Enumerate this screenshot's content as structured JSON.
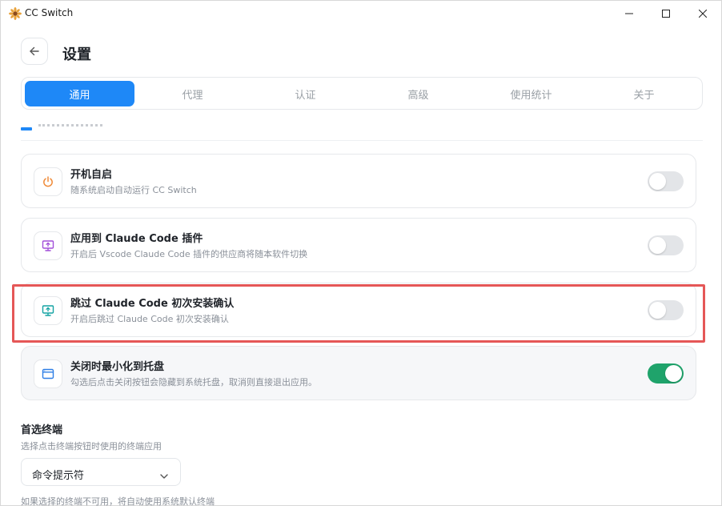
{
  "window": {
    "title": "CC Switch",
    "icon": "sunflower-app-icon"
  },
  "header": {
    "back_icon": "arrow-left-icon",
    "title": "设置"
  },
  "tabs": [
    {
      "label": "通用",
      "active": true
    },
    {
      "label": "代理",
      "active": false
    },
    {
      "label": "认证",
      "active": false
    },
    {
      "label": "高级",
      "active": false
    },
    {
      "label": "使用统计",
      "active": false
    },
    {
      "label": "关于",
      "active": false
    }
  ],
  "settings": [
    {
      "title": "开机自启",
      "desc": "随系统启动自动运行 CC Switch",
      "icon": "power-icon",
      "enabled": false
    },
    {
      "title": "应用到 Claude Code 插件",
      "desc": "开启后 Vscode Claude Code 插件的供应商将随本软件切换",
      "icon": "monitor-upload-icon",
      "enabled": false
    },
    {
      "title": "跳过 Claude Code 初次安装确认",
      "desc": "开启后跳过 Claude Code 初次安装确认",
      "icon": "monitor-upload-icon",
      "enabled": false
    },
    {
      "title": "关闭时最小化到托盘",
      "desc": "勾选后点击关闭按钮会隐藏到系统托盘，取消则直接退出应用。",
      "icon": "window-icon",
      "enabled": true
    }
  ],
  "terminal": {
    "title": "首选终端",
    "desc": "选择点击终端按钮时使用的终端应用",
    "selected": "命令提示符",
    "note": "如果选择的终端不可用，将自动使用系统默认终端"
  },
  "colors": {
    "accent": "#1e88f7",
    "toggle_on": "#1fa36b",
    "highlight": "#e55757"
  }
}
